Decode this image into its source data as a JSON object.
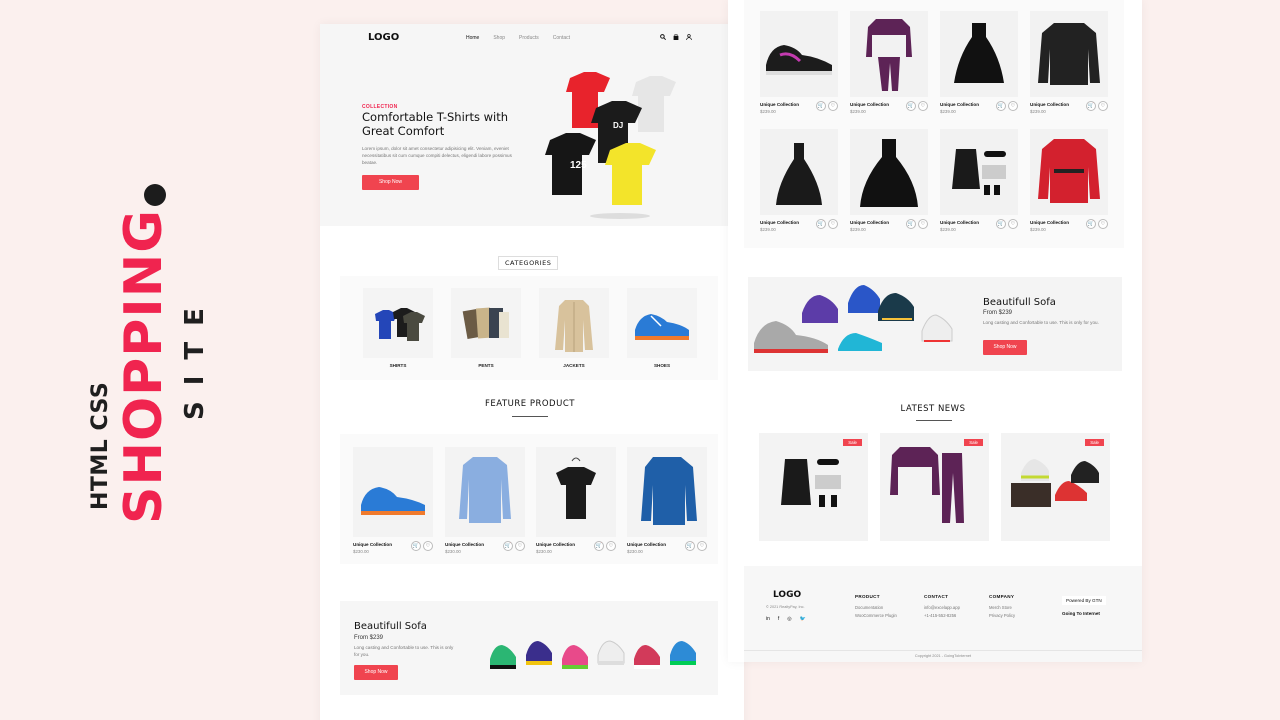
{
  "side_title": {
    "top": "HTML CSS",
    "main": "SHOPPING",
    "bottom": "SITE"
  },
  "nav": {
    "logo": "LOGO",
    "links": [
      "Home",
      "Shop",
      "Products",
      "Contact"
    ]
  },
  "hero": {
    "kicker": "COLLECTION",
    "title": "Comfortable T-Shirts with Great Comfort",
    "desc": "Lorem ipsum, dolor sit amet consectetur adipisicing elit. Veniam, eveniet necessitatibus sit cum cumque compiti delectus, eligendi labore possimus beatae.",
    "button": "Shop Now"
  },
  "categories": {
    "title": "CATEGORIES",
    "items": [
      "SHIRTS",
      "PENTS",
      "JACKETS",
      "SHOES"
    ]
  },
  "featured": {
    "title": "FEATURE PRODUCT",
    "items": [
      {
        "name": "Unique Collection",
        "price": "$230.00"
      },
      {
        "name": "Unique Collection",
        "price": "$230.00"
      },
      {
        "name": "Unique Collection",
        "price": "$230.00"
      },
      {
        "name": "Unique Collection",
        "price": "$230.00"
      }
    ]
  },
  "banner1": {
    "title": "Beautifull Sofa",
    "from": "From $239",
    "desc": "Long casting and Confortable to use. This is only for you.",
    "button": "Shop Now"
  },
  "grid": {
    "items": [
      {
        "name": "Unique Collection",
        "price": "$239.00"
      },
      {
        "name": "Unique Collection",
        "price": "$239.00"
      },
      {
        "name": "Unique Collection",
        "price": "$239.00"
      },
      {
        "name": "Unique Collection",
        "price": "$239.00"
      },
      {
        "name": "Unique Collection",
        "price": "$239.00"
      },
      {
        "name": "Unique Collection",
        "price": "$239.00"
      },
      {
        "name": "Unique Collection",
        "price": "$239.00"
      },
      {
        "name": "Unique Collection",
        "price": "$239.00"
      }
    ]
  },
  "banner2": {
    "title": "Beautifull Sofa",
    "from": "From $239",
    "desc": "Long casting and Confortable to use. This is only for you.",
    "button": "Shop Now"
  },
  "news": {
    "title": "LATEST NEWS",
    "badge": "Sale"
  },
  "footer": {
    "logo": "LOGO",
    "copy": "© 2021 RealtyPay, Inc.",
    "cols": [
      {
        "h": "PRODUCT",
        "items": [
          "Documentation",
          "WooCommerce Plugin"
        ]
      },
      {
        "h": "CONTACT",
        "items": [
          "info@excelapp.app",
          "+1-415-552-8256"
        ]
      },
      {
        "h": "COMPANY",
        "items": [
          "Merch Store",
          "Privacy Policy"
        ]
      }
    ],
    "powered": "Powered By GTN",
    "going": "Going To Internet",
    "bottom": "Copyright 2021 - GoingToInternet"
  },
  "colors": {
    "accent": "#f0244f",
    "button": "#f0444f"
  },
  "icons": {
    "nav": [
      "search-icon",
      "bag-icon",
      "user-icon"
    ],
    "product_actions": [
      "cart-icon",
      "heart-icon"
    ],
    "social": [
      "linkedin-icon",
      "facebook-icon",
      "instagram-icon",
      "twitter-icon"
    ]
  }
}
